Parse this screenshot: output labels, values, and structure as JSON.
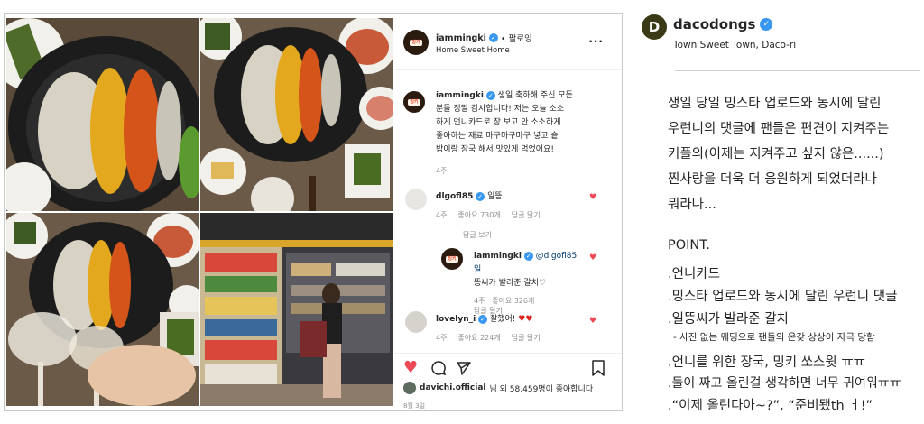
{
  "post": {
    "header": {
      "username": "iammingki",
      "follow": "• 팔로잉",
      "location": "Home Sweet Home",
      "avatar_text": "밍키"
    },
    "caption": {
      "username": "iammingki",
      "lines": [
        "생일 축하해 주신 모든",
        "분들 정말 감사합니다! 저는 오늘 소소",
        "하게 언니카드로 장 보고 안 소소하게",
        "좋아하는 재료 마구마구마구 넣고 솥",
        "밥이랑 장국 해서 맛있게 먹었어요!"
      ],
      "time": "4주"
    },
    "comments": [
      {
        "username": "dlgofl85",
        "text": "일뜽",
        "time": "4주",
        "likes": "좋아요 730개",
        "reply": "답글 달기",
        "view_replies": "답글 보기"
      },
      {
        "username": "iammingki",
        "text_lines": [
          "@dlgofl85 일",
          "뜽씨가 발라준 갈치♡"
        ],
        "time": "4주",
        "likes": "좋아요 326개",
        "reply": "답글 달기"
      },
      {
        "username": "lovelyn_i",
        "text": "잘했어!",
        "time": "4주",
        "likes": "좋아요 224개",
        "reply": "답글 달기"
      }
    ],
    "likes": {
      "username": "davichi.official",
      "text": "님 외 58,459명이 좋아합니다"
    },
    "date": "8월 3일",
    "icons": {
      "like": "heart-icon",
      "comment": "comment-icon",
      "share": "share-icon",
      "save": "bookmark-icon",
      "more": "more-icon"
    }
  },
  "blog": {
    "avatar_letter": "D",
    "username": "dacodongs",
    "location": "Town Sweet Town, Daco-ri",
    "paragraph": [
      "생일 당일 밍스타 업로드와 동시에 달린",
      "우런니의 댓글에 팬들은 편견이 지켜주는",
      "커플의(이제는 지켜주고 싶지 않은......)",
      "찐사랑을 더욱 더 응원하게 되었더라나",
      "뭐라나..."
    ],
    "point_title": "POINT.",
    "points": [
      ".언니카드",
      ".밍스타 업로드와 동시에 달린 우런니 댓글",
      ".일뜽씨가 발라준 갈치"
    ],
    "note": "- 사진 없는 웨딩으로 팬들의 온갖 상상이 자극 당함",
    "points2": [
      ".언니를 위한 장국, 밍키 쏘스윗 ㅠㅠ",
      ".둘이 짜고 올린걸 생각하면 너무 귀여워ㅠㅠ",
      ".“이제 올린다아~?”, “준비됐th ㅓ!”"
    ]
  },
  "colors": {
    "verified": "#3897f0",
    "heart": "#ed4956",
    "muted": "#8e8e8e",
    "text": "#262626"
  }
}
